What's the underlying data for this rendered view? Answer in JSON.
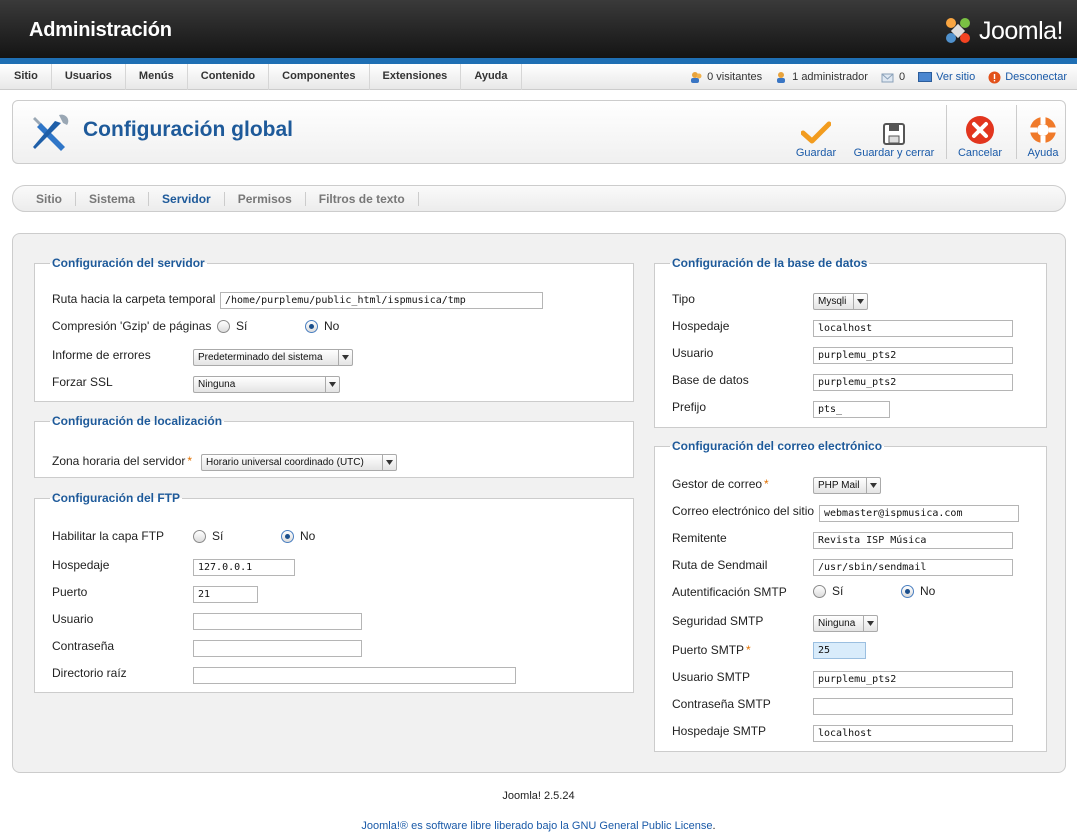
{
  "header": {
    "title": "Administración",
    "logo_text": "Joomla!"
  },
  "menu": [
    "Sitio",
    "Usuarios",
    "Menús",
    "Contenido",
    "Componentes",
    "Extensiones",
    "Ayuda"
  ],
  "status": {
    "visitors": "0 visitantes",
    "admins": "1 administrador",
    "messages": "0",
    "view_site": "Ver sitio",
    "logout": "Desconectar"
  },
  "toolbar": {
    "title": "Configuración global",
    "save": "Guardar",
    "save_close": "Guardar y cerrar",
    "cancel": "Cancelar",
    "help": "Ayuda"
  },
  "tabs": [
    "Sitio",
    "Sistema",
    "Servidor",
    "Permisos",
    "Filtros de texto"
  ],
  "active_tab": "Servidor",
  "server": {
    "legend": "Configuración del servidor",
    "tmp_label": "Ruta hacia la carpeta temporal",
    "tmp_value": "/home/purplemu/public_html/ispmusica/tmp",
    "gzip_label": "Compresión 'Gzip' de páginas",
    "yes": "Sí",
    "no": "No",
    "errors_label": "Informe de errores",
    "errors_value": "Predeterminado del sistema",
    "ssl_label": "Forzar SSL",
    "ssl_value": "Ninguna"
  },
  "locale": {
    "legend": "Configuración de localización",
    "tz_label": "Zona horaria del servidor",
    "tz_value": "Horario universal coordinado (UTC)"
  },
  "ftp": {
    "legend": "Configuración del FTP",
    "enable_label": "Habilitar la capa FTP",
    "yes": "Sí",
    "no": "No",
    "host_label": "Hospedaje",
    "host_value": "127.0.0.1",
    "port_label": "Puerto",
    "port_value": "21",
    "user_label": "Usuario",
    "user_value": "",
    "pass_label": "Contraseña",
    "pass_value": "",
    "root_label": "Directorio raíz",
    "root_value": ""
  },
  "db": {
    "legend": "Configuración de la base de datos",
    "type_label": "Tipo",
    "type_value": "Mysqli",
    "host_label": "Hospedaje",
    "host_value": "localhost",
    "user_label": "Usuario",
    "user_value": "purplemu_pts2",
    "name_label": "Base de datos",
    "name_value": "purplemu_pts2",
    "prefix_label": "Prefijo",
    "prefix_value": "pts_"
  },
  "mail": {
    "legend": "Configuración del correo electrónico",
    "mailer_label": "Gestor de correo",
    "mailer_value": "PHP Mail",
    "from_label": "Correo electrónico del sitio",
    "from_value": "webmaster@ispmusica.com",
    "sender_label": "Remitente",
    "sender_value": "Revista ISP Música",
    "sendmail_label": "Ruta de Sendmail",
    "sendmail_value": "/usr/sbin/sendmail",
    "auth_label": "Autentificación SMTP",
    "yes": "Sí",
    "no": "No",
    "security_label": "Seguridad SMTP",
    "security_value": "Ninguna",
    "port_label": "Puerto SMTP",
    "port_value": "25",
    "smtp_user_label": "Usuario SMTP",
    "smtp_user_value": "purplemu_pts2",
    "smtp_pass_label": "Contraseña SMTP",
    "smtp_pass_value": "",
    "smtp_host_label": "Hospedaje SMTP",
    "smtp_host_value": "localhost"
  },
  "footer": {
    "version": "Joomla! 2.5.24",
    "license_prefix": "Joomla!® es software libre liberado bajo la ",
    "license_link": "GNU General Public License",
    "license_suffix": "."
  },
  "colors": {
    "accent": "#1e5a9a",
    "header_bar": "#1f6fb4",
    "required": "#e07000"
  }
}
